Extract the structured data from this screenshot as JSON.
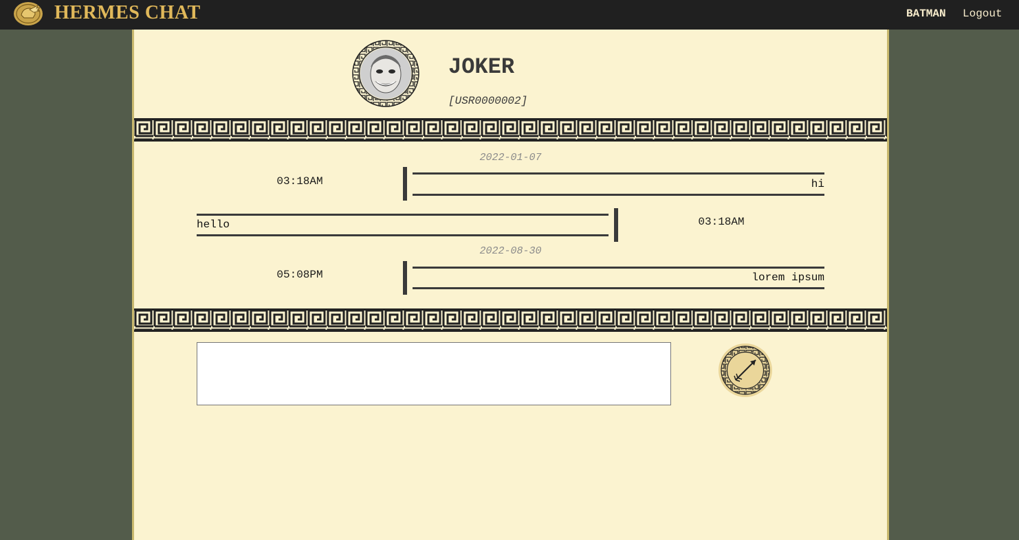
{
  "header": {
    "brand": "HERMES CHAT",
    "logo_icon": "winged-helmet-icon",
    "username": "BATMAN",
    "logout_label": "Logout"
  },
  "contact": {
    "name": "JOKER",
    "id": "[USR0000002]",
    "avatar_icon": "joker-avatar"
  },
  "conversation": {
    "groups": [
      {
        "date": "2022-01-07",
        "messages": [
          {
            "direction": "incoming",
            "time": "03:18AM",
            "text": "hi"
          },
          {
            "direction": "outgoing",
            "time": "03:18AM",
            "text": "hello"
          }
        ]
      },
      {
        "date": "2022-08-30",
        "messages": [
          {
            "direction": "incoming",
            "time": "05:08PM",
            "text": "lorem ipsum"
          }
        ]
      }
    ]
  },
  "composer": {
    "value": "",
    "placeholder": "",
    "send_icon": "arrow-send-icon"
  },
  "colors": {
    "topbar": "#202020",
    "brand": "#e0b85a",
    "page_bg": "#535c4b",
    "panel_bg": "#fbf3d0",
    "ink": "#3a3a3a"
  }
}
